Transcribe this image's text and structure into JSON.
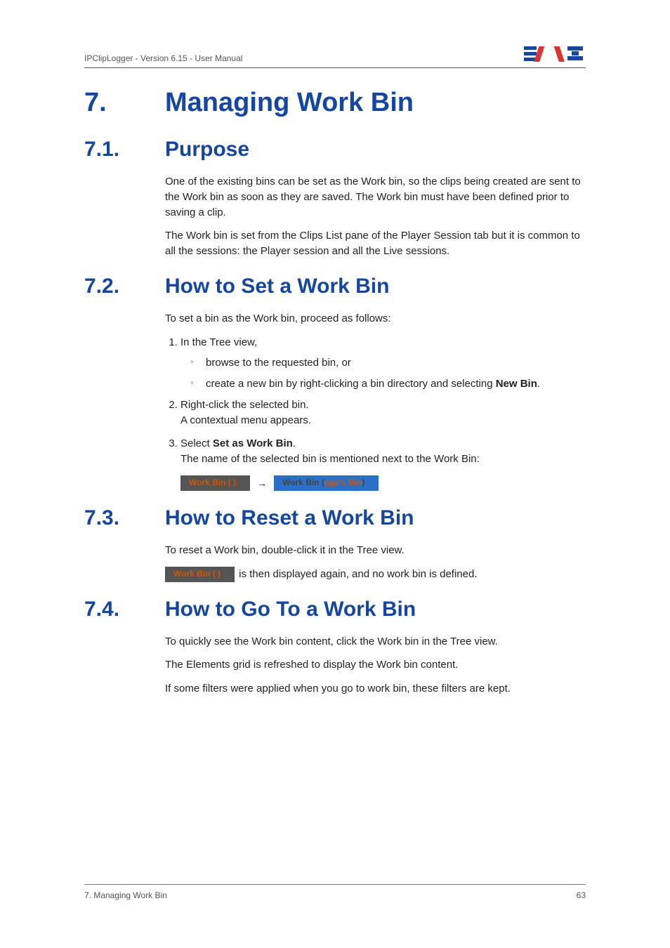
{
  "header": {
    "left": "IPClipLogger - Version 6.15 - User Manual"
  },
  "h1": {
    "num": "7.",
    "text": "Managing Work Bin"
  },
  "s71": {
    "num": "7.1.",
    "title": "Purpose",
    "p1": "One of the existing bins can be set as the Work bin, so the clips being created are sent to the Work bin as soon as they are saved. The Work bin must have been defined prior to saving a clip.",
    "p2": "The Work bin is set from the Clips List pane of the Player Session tab but it is common to all the sessions: the Player session and all the Live sessions."
  },
  "s72": {
    "num": "7.2.",
    "title": "How to Set a Work Bin",
    "intro": "To set a bin as the Work bin, proceed as follows:",
    "step1": "In the Tree view,",
    "step1a": "browse to the requested bin, or",
    "step1b_pre": "create a new bin by right-clicking a bin directory and selecting ",
    "step1b_bold": "New Bin",
    "step1b_post": ".",
    "step2": "Right-click the selected bin.",
    "step2_after": "A contextual menu appears.",
    "step3_pre": "Select ",
    "step3_bold": "Set as Work Bin",
    "step3_post": ".",
    "step3_after": "The name of the selected bin is mentioned next to the Work Bin:",
    "chip_empty": "Work Bin ( )",
    "arrow": "→",
    "chip_full_prefix": "Work Bin (",
    "chip_full_pge": "pge's Bin",
    "chip_full_suffix": ")"
  },
  "s73": {
    "num": "7.3.",
    "title": "How to Reset a Work Bin",
    "p1": "To reset a Work bin, double-click it in the Tree view.",
    "chip": "Work Bin ( )",
    "after_chip": " is then displayed again, and no work bin is defined."
  },
  "s74": {
    "num": "7.4.",
    "title": "How to Go To a Work Bin",
    "p1": "To quickly see the Work bin content, click the Work bin in the Tree view.",
    "p2": "The Elements grid is refreshed to display the Work bin content.",
    "p3": "If some filters were applied when you go to work bin, these filters are kept."
  },
  "footer": {
    "left": "7. Managing Work Bin",
    "right": "63"
  }
}
